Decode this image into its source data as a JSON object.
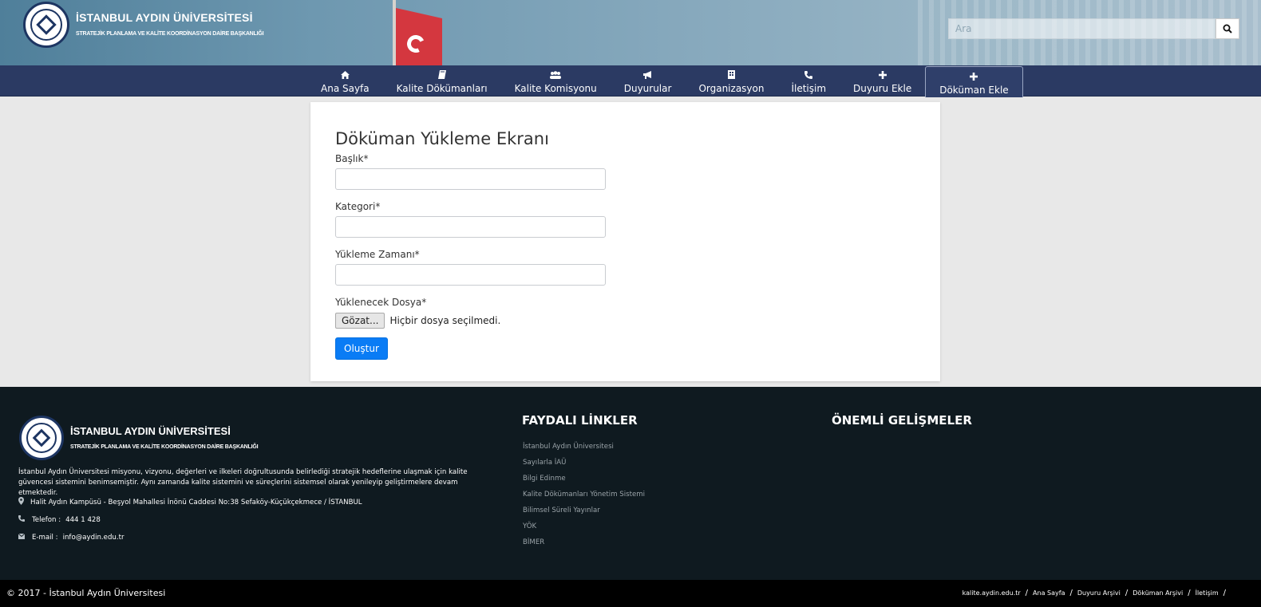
{
  "header": {
    "title": "İSTANBUL AYDIN ÜNİVERSİTESİ",
    "subtitle": "STRATEJİK PLANLAMA VE KALİTE KOORDİNASYON DAİRE BAŞKANLIĞI",
    "search_placeholder": "Ara"
  },
  "nav": {
    "items": [
      {
        "label": "Ana Sayfa",
        "icon": "home-icon"
      },
      {
        "label": "Kalite Dökümanları",
        "icon": "book-icon"
      },
      {
        "label": "Kalite Komisyonu",
        "icon": "users-icon"
      },
      {
        "label": "Duyurular",
        "icon": "megaphone-icon"
      },
      {
        "label": "Organizasyon",
        "icon": "building-icon"
      },
      {
        "label": "İletişim",
        "icon": "phone-icon"
      },
      {
        "label": "Duyuru Ekle",
        "icon": "plus-icon"
      },
      {
        "label": "Döküman Ekle",
        "icon": "plus-icon",
        "active": true
      }
    ]
  },
  "form": {
    "title": "Döküman Yükleme Ekranı",
    "fields": [
      {
        "label": "Başlık*",
        "value": ""
      },
      {
        "label": "Kategori*",
        "value": ""
      },
      {
        "label": "Yükleme Zamanı*",
        "value": ""
      }
    ],
    "file_label": "Yüklenecek Dosya*",
    "file_button": "Gözat...",
    "file_status": "Hiçbir dosya seçilmedi.",
    "submit": "Oluştur"
  },
  "footer": {
    "title": "İSTANBUL AYDIN ÜNİVERSİTESİ",
    "subtitle": "STRATEJİK PLANLAMA VE KALİTE KOORDİNASYON DAİRE BAŞKANLIĞI",
    "description": "İstanbul Aydın Üniversitesi misyonu, vizyonu, değerleri ve ilkeleri doğrultusunda belirlediği stratejik hedeflerine ulaşmak için kalite güvencesi sistemini benimsemiştir. Aynı zamanda kalite sistemini ve süreçlerini sistemsel olarak yenileyip geliştirmelere devam etmektedir.",
    "address": "Halit Aydın Kampüsü - Beşyol Mahallesi İnönü Caddesi No:38 Sefaköy-Küçükçekmece / İSTANBUL",
    "phone_label": "Telefon :",
    "phone": "444 1 428",
    "email_label": "E-mail :",
    "email": "info@aydin.edu.tr",
    "links_heading": "FAYDALI LİNKLER",
    "links": [
      "İstanbul Aydın Üniversitesi",
      "Sayılarla İAÜ",
      "Bilgi Edinme",
      "Kalite Dökümanları Yönetim Sistemi",
      "Bilimsel Süreli Yayınlar",
      "YÖK",
      "BİMER"
    ],
    "news_heading": "ÖNEMLİ GELİŞMELER"
  },
  "bottom": {
    "copyright": "© 2017 - İstanbul Aydın Üniversitesi",
    "links": [
      "kalite.aydin.edu.tr",
      "Ana Sayfa",
      "Duyuru Arşivi",
      "Döküman Arşivi",
      "İletişim"
    ]
  }
}
